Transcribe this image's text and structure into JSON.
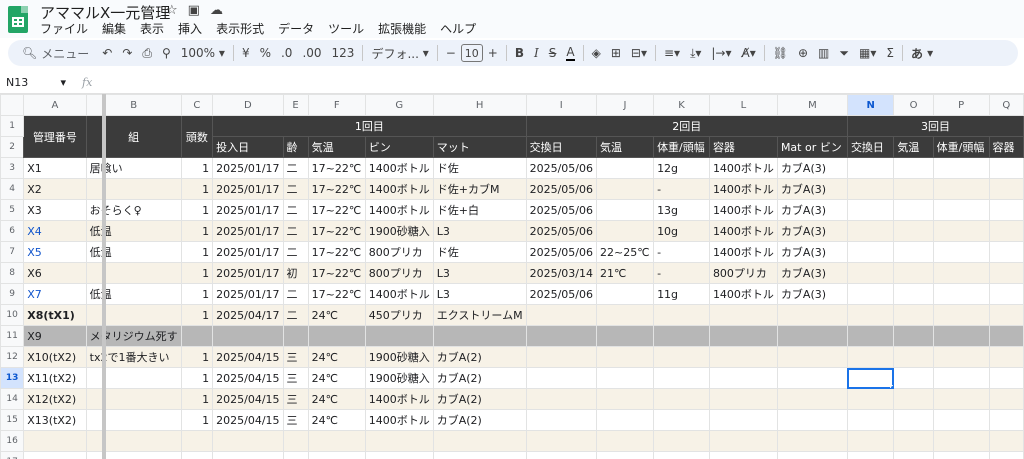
{
  "app": {
    "doc_title": "アママルX一元管理",
    "menu": [
      "ファイル",
      "編集",
      "表示",
      "挿入",
      "表示形式",
      "データ",
      "ツール",
      "拡張機能",
      "ヘルプ"
    ]
  },
  "toolbar": {
    "search_label": "メニュー",
    "zoom": "100%",
    "currency": "¥",
    "percent": "%",
    "decrease_decimal": ".0",
    "increase_decimal": ".00",
    "number_format": "123",
    "font_name": "デフォ...",
    "font_size": "10",
    "minus": "−",
    "plus": "+",
    "bold": "B",
    "italic": "I",
    "strike": "S",
    "text_color": "A",
    "sigma": "Σ",
    "input_tools": "あ"
  },
  "formula_bar": {
    "cell_ref": "N13",
    "fx": "fx",
    "value": ""
  },
  "columns": [
    "A",
    "B",
    "C",
    "D",
    "E",
    "F",
    "G",
    "H",
    "I",
    "J",
    "K",
    "L",
    "M",
    "N",
    "O",
    "P",
    "Q"
  ],
  "selected_column": "N",
  "selected_row": "13",
  "header_row1": {
    "row_num": "1",
    "a": "管理番号",
    "b": "組",
    "c": "頭数",
    "group1": "1回目",
    "group2": "2回目",
    "group3": "3回目"
  },
  "header_row2": {
    "row_num": "2",
    "cells": [
      "投入日",
      "齢",
      "気温",
      "ビン",
      "マット",
      "交換日",
      "気温",
      "体重/頭幅",
      "容器",
      "Mat or ビン",
      "交換日",
      "気温",
      "体重/頭幅",
      "容器"
    ]
  },
  "rows": [
    {
      "n": "3",
      "cells": [
        "X1",
        "居喰い",
        "1",
        "2025/01/17",
        "二",
        "17~22℃",
        "1400ボトル",
        "ド佐",
        "2025/05/06",
        "",
        "12g",
        "1400ボトル",
        "カブA(3)",
        "",
        "",
        "",
        ""
      ]
    },
    {
      "n": "4",
      "cells": [
        "X2",
        "",
        "1",
        "2025/01/17",
        "二",
        "17~22℃",
        "1400ボトル",
        "ド佐+カブM",
        "2025/05/06",
        "",
        "-",
        "1400ボトル",
        "カブA(3)",
        "",
        "",
        "",
        ""
      ]
    },
    {
      "n": "5",
      "cells": [
        "X3",
        "おそらく♀",
        "1",
        "2025/01/17",
        "二",
        "17~22℃",
        "1400ボトル",
        "ド佐+白",
        "2025/05/06",
        "",
        "13g",
        "1400ボトル",
        "カブA(3)",
        "",
        "",
        "",
        ""
      ]
    },
    {
      "n": "6",
      "cells": [
        "X4",
        "低温",
        "1",
        "2025/01/17",
        "二",
        "17~22℃",
        "1900砂糖入",
        "L3",
        "2025/05/06",
        "",
        "10g",
        "1400ボトル",
        "カブA(3)",
        "",
        "",
        "",
        ""
      ]
    },
    {
      "n": "7",
      "cells": [
        "X5",
        "低温",
        "1",
        "2025/01/17",
        "二",
        "17~22℃",
        "800プリカ",
        "ド佐",
        "2025/05/06",
        "22~25℃",
        "-",
        "1400ボトル",
        "カブA(3)",
        "",
        "",
        "",
        ""
      ]
    },
    {
      "n": "8",
      "cells": [
        "X6",
        "",
        "1",
        "2025/01/17",
        "初",
        "17~22℃",
        "800プリカ",
        "L3",
        "2025/03/14",
        "21℃",
        "-",
        "800プリカ",
        "カブA(3)",
        "",
        "",
        "",
        ""
      ]
    },
    {
      "n": "9",
      "cells": [
        "X7",
        "低温",
        "1",
        "2025/01/17",
        "二",
        "17~22℃",
        "1400ボトル",
        "L3",
        "2025/05/06",
        "",
        "11g",
        "1400ボトル",
        "カブA(3)",
        "",
        "",
        "",
        ""
      ]
    },
    {
      "n": "10",
      "cells": [
        "X8(tX1)",
        "",
        "1",
        "2025/04/17",
        "二",
        "24℃",
        "450プリカ",
        "エクストリームM",
        "",
        "",
        "",
        "",
        "",
        "",
        "",
        "",
        ""
      ]
    },
    {
      "n": "11",
      "cells": [
        "X9",
        "メタリジウム死す",
        "",
        "",
        "",
        "",
        "",
        "",
        "",
        "",
        "",
        "",
        "",
        "",
        "",
        "",
        ""
      ]
    },
    {
      "n": "12",
      "cells": [
        "X10(tX2)",
        "tx2で1番大きい",
        "1",
        "2025/04/15",
        "三",
        "24℃",
        "1900砂糖入",
        "カブA(2)",
        "",
        "",
        "",
        "",
        "",
        "",
        "",
        "",
        ""
      ]
    },
    {
      "n": "13",
      "cells": [
        "X11(tX2)",
        "",
        "1",
        "2025/04/15",
        "三",
        "24℃",
        "1900砂糖入",
        "カブA(2)",
        "",
        "",
        "",
        "",
        "",
        "",
        "",
        "",
        ""
      ]
    },
    {
      "n": "14",
      "cells": [
        "X12(tX2)",
        "",
        "1",
        "2025/04/15",
        "三",
        "24℃",
        "1400ボトル",
        "カブA(2)",
        "",
        "",
        "",
        "",
        "",
        "",
        "",
        "",
        ""
      ]
    },
    {
      "n": "15",
      "cells": [
        "X13(tX2)",
        "",
        "1",
        "2025/04/15",
        "三",
        "24℃",
        "1400ボトル",
        "カブA(2)",
        "",
        "",
        "",
        "",
        "",
        "",
        "",
        "",
        ""
      ]
    },
    {
      "n": "16",
      "cells": [
        "",
        "",
        "",
        "",
        "",
        "",
        "",
        "",
        "",
        "",
        "",
        "",
        "",
        "",
        "",
        "",
        ""
      ]
    },
    {
      "n": "17",
      "cells": [
        "",
        "",
        "",
        "",
        "",
        "",
        "",
        "",
        "",
        "",
        "",
        "",
        "",
        "",
        "",
        "",
        ""
      ]
    }
  ],
  "colors": {
    "header_dark": "#3b3b3b",
    "stripe": "#f7f2e7",
    "gray_row": "#b7b7b7",
    "link_blue": "#1155cc",
    "selection": "#1a73e8"
  }
}
